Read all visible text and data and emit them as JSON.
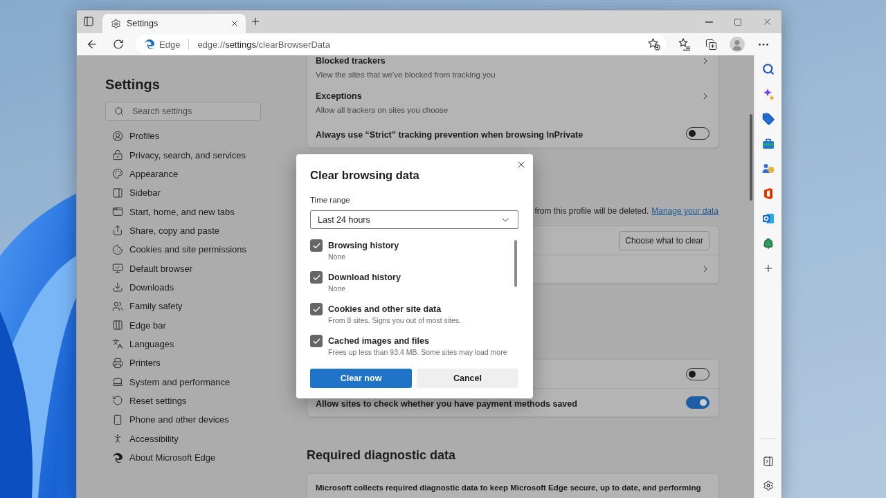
{
  "window": {
    "tabs": [
      {
        "title": "Settings",
        "selected": true
      }
    ]
  },
  "address_bar": {
    "site_label": "Edge",
    "url": {
      "scheme": "edge://",
      "host": "settings",
      "path": "/clearBrowserData"
    }
  },
  "settings_nav": {
    "title": "Settings",
    "search": {
      "placeholder": "Search settings"
    },
    "items": [
      {
        "label": "Profiles"
      },
      {
        "label": "Privacy, search, and services"
      },
      {
        "label": "Appearance"
      },
      {
        "label": "Sidebar"
      },
      {
        "label": "Start, home, and new tabs"
      },
      {
        "label": "Share, copy and paste"
      },
      {
        "label": "Cookies and site permissions"
      },
      {
        "label": "Default browser"
      },
      {
        "label": "Downloads"
      },
      {
        "label": "Family safety"
      },
      {
        "label": "Edge bar"
      },
      {
        "label": "Languages"
      },
      {
        "label": "Printers"
      },
      {
        "label": "System and performance"
      },
      {
        "label": "Reset settings"
      },
      {
        "label": "Phone and other devices"
      },
      {
        "label": "Accessibility"
      },
      {
        "label": "About Microsoft Edge"
      }
    ]
  },
  "tracking_card": {
    "rows": [
      {
        "kind": "link",
        "title": "Blocked trackers",
        "description": "View the sites that we've blocked from tracking you"
      },
      {
        "kind": "link",
        "title": "Exceptions",
        "description": "Allow all trackers on sites you choose"
      },
      {
        "kind": "toggle",
        "title": "Always use “Strict” tracking prevention when browsing InPrivate",
        "on": false
      }
    ]
  },
  "clear_data": {
    "description": "from this profile will be deleted.",
    "link": "Manage your data",
    "card_rows": [
      {
        "kind": "button",
        "button": "Choose what to clear"
      },
      {
        "kind": "link"
      }
    ]
  },
  "payment_card": {
    "rows": [
      {
        "kind": "toggle",
        "on": false
      },
      {
        "kind": "toggle",
        "title": "Allow sites to check whether you have payment methods saved",
        "on": true
      }
    ]
  },
  "diagnostic": {
    "heading": "Required diagnostic data",
    "description": "Microsoft collects required diagnostic data to keep Microsoft Edge secure, up to date, and performing"
  },
  "dialog": {
    "title": "Clear browsing data",
    "time_range": {
      "label": "Time range",
      "value": "Last 24 hours"
    },
    "items": [
      {
        "label": "Browsing history",
        "detail": "None",
        "checked": true
      },
      {
        "label": "Download history",
        "detail": "None",
        "checked": true
      },
      {
        "label": "Cookies and other site data",
        "detail": "From 8 sites. Signs you out of most sites.",
        "checked": true
      },
      {
        "label": "Cached images and files",
        "detail": "Frees up less than 93.4 MB. Some sites may load more",
        "checked": true
      }
    ],
    "buttons": [
      {
        "label": "Clear now",
        "kind": "primary"
      },
      {
        "label": "Cancel",
        "kind": "secondary"
      }
    ]
  }
}
